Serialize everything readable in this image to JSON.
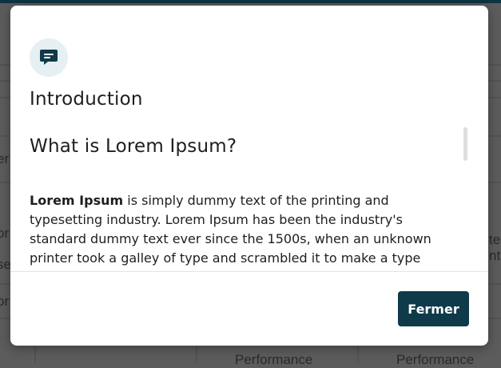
{
  "background": {
    "fragments": [
      "er",
      "or",
      "se",
      "or",
      "te",
      "ntif",
      "Performance",
      "Performance"
    ]
  },
  "dialog": {
    "icon": "message-square-text-icon",
    "title": "Introduction",
    "heading": "What is Lorem Ipsum?",
    "paragraph_bold": "Lorem Ipsum",
    "paragraph_text": " is simply dummy text of the printing and typesetting industry. Lorem Ipsum has been the industry's standard dummy text ever since the 1500s, when an unknown printer took a galley of type and scrambled it to make a type specimen book. It has survived",
    "close_label": "Fermer"
  },
  "colors": {
    "accent": "#0e3a4a",
    "icon_bg": "#e6eff2"
  }
}
